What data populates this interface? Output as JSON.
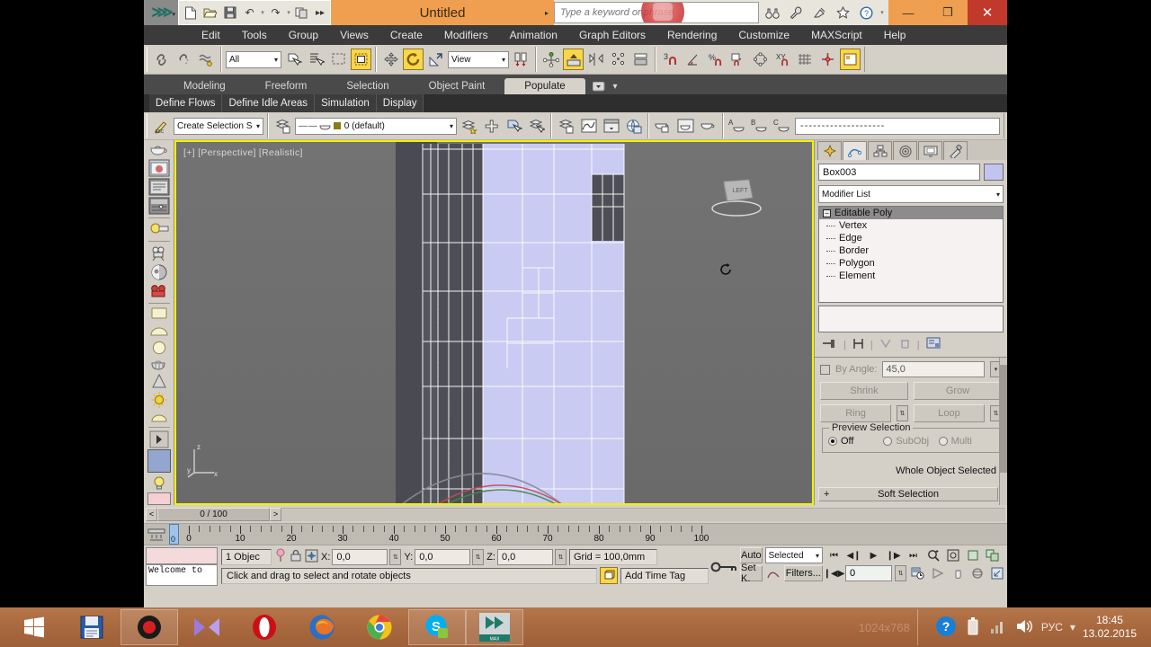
{
  "titlebar": {
    "app_logo": "3dsmax-logo-icon",
    "quick_access": [
      {
        "name": "new-file-icon",
        "glyph": "🗋"
      },
      {
        "name": "open-file-icon",
        "glyph": "🗁"
      },
      {
        "name": "save-file-icon",
        "glyph": "🖫"
      },
      {
        "name": "undo-icon",
        "glyph": "↶"
      },
      {
        "name": "redo-icon",
        "glyph": "↷"
      },
      {
        "name": "set-project-folder-icon",
        "glyph": "🗂"
      }
    ],
    "title": "Untitled",
    "search_placeholder": "Type a keyword or phrase",
    "help_icons": [
      "binoculars-icon",
      "wrench-icon",
      "satellite-icon",
      "star-icon",
      "help-icon"
    ],
    "window_buttons": {
      "minimize": "—",
      "maximize": "❐",
      "close": "✕"
    }
  },
  "menubar": {
    "items": [
      "Edit",
      "Tools",
      "Group",
      "Views",
      "Create",
      "Modifiers",
      "Animation",
      "Graph Editors",
      "Rendering",
      "Customize",
      "MAXScript",
      "Help"
    ]
  },
  "main_toolbar": {
    "selection_filter": "All",
    "reference_coordinate_system": "View",
    "active_tool": "rotate",
    "groups": [
      {
        "name": "link-group",
        "icons": [
          "select-and-link-icon",
          "unlink-selection-icon",
          "bind-to-space-warp-icon"
        ]
      },
      {
        "name": "select-group",
        "icons": [
          "select-object-icon",
          "select-by-name-icon",
          "rectangular-region-icon",
          "window-crossing-icon"
        ]
      },
      {
        "name": "transform-group",
        "icons": [
          "select-and-move-icon",
          "select-and-rotate-icon",
          "select-and-scale-icon"
        ]
      },
      {
        "name": "pivot-group",
        "icons": [
          "use-pivot-point-center-icon",
          "selection-lock-toggle-icon"
        ]
      },
      {
        "name": "align-group",
        "icons": [
          "mirror-icon",
          "align-icon",
          "layer-manager-icon"
        ]
      },
      {
        "name": "snap-group",
        "icons": [
          "snaps-toggle-3-icon",
          "angle-snap-icon",
          "percent-snap-icon",
          "spinner-snap-icon",
          "named-selection-icon",
          "xy-icon",
          "grid-icon",
          "manipulate-icon",
          "render-setup-icon"
        ]
      }
    ]
  },
  "ribbon": {
    "tabs": [
      {
        "label": "Modeling",
        "active": false
      },
      {
        "label": "Freeform",
        "active": false
      },
      {
        "label": "Selection",
        "active": false
      },
      {
        "label": "Object Paint",
        "active": false
      },
      {
        "label": "Populate",
        "active": true
      }
    ],
    "dropdown_icon": "ribbon-options-icon",
    "subtabs": [
      "Define Flows",
      "Define Idle Areas",
      "Simulation",
      "Display"
    ]
  },
  "layer_toolbar": {
    "selection_set": "Create Selection Se",
    "layer": "0 (default)",
    "layer_icons": [
      "layer-manager-icon",
      "create-layer-icon",
      "add-to-layer-icon",
      "select-layer-objects-icon"
    ],
    "curve_editor_icons": [
      "curve-editor-icon",
      "schematic-view-icon",
      "track-view-icon",
      "render-in-browser-icon"
    ],
    "material_icons": [
      "material-editor-icon",
      "compact-material-editor-icon",
      "material-explorer-icon"
    ],
    "abc_icons": [
      "render-production-icon",
      "render-iterative-icon",
      "render-activeshade-icon"
    ],
    "material_dash": "- - - - - - - - - - - - - - - - - - - -"
  },
  "left_toolbar": {
    "items": [
      "teapot-icon",
      "render-frame-icon",
      "render-setup-icon",
      "render-presets-icon",
      "light-lister-icon",
      "camera-icon",
      "shadow-icon",
      "camera-red-icon",
      "box-primitive-icon",
      "sphere-primitive-icon",
      "circle-primitive-icon",
      "teapot-primitive-icon",
      "cone-primitive-icon",
      "sun-icon",
      "light-icon"
    ]
  },
  "viewport": {
    "label": "[+] [Perspective] [Realistic]",
    "viewcube_face": "LEFT",
    "cursor": "rotate-cursor",
    "axis_labels": {
      "z": "z",
      "y": "y",
      "x": "x"
    },
    "border_color": "#f5f000",
    "selection_color": "#c9cbf2",
    "object_name": "Box003"
  },
  "command_panel": {
    "tabs": [
      "create-tab-icon",
      "modify-tab-icon",
      "hierarchy-tab-icon",
      "motion-tab-icon",
      "display-tab-icon",
      "utilities-tab-icon"
    ],
    "active_tab_index": 1,
    "object_name": "Box003",
    "color_swatch": "#c3c3ef",
    "modifier_list_label": "Modifier List",
    "modifier_stack": {
      "root": "Editable Poly",
      "sub_objects": [
        "Vertex",
        "Edge",
        "Border",
        "Polygon",
        "Element"
      ]
    },
    "stack_buttons": [
      "pin-stack-icon",
      "show-end-result-icon",
      "make-unique-icon",
      "remove-modifier-icon",
      "configure-sets-icon"
    ],
    "selection_rollout": {
      "by_angle_label": "By Angle:",
      "by_angle_value": "45,0",
      "shrink": "Shrink",
      "grow": "Grow",
      "ring": "Ring",
      "loop": "Loop",
      "preview_title": "Preview Selection",
      "preview_options": [
        {
          "label": "Off",
          "selected": true
        },
        {
          "label": "SubObj",
          "selected": false
        },
        {
          "label": "Multi",
          "selected": false
        }
      ],
      "status": "Whole Object Selected"
    },
    "soft_selection": "Soft Selection"
  },
  "timeline": {
    "prev_arrow": "<",
    "next_arrow": ">",
    "current": "0 / 100",
    "frame_indicator": "0",
    "ruler_labels": [
      "0",
      "10",
      "20",
      "30",
      "40",
      "50",
      "60",
      "70",
      "80",
      "90",
      "100"
    ],
    "range_start": 0,
    "range_end": 100
  },
  "statusbar": {
    "listener_text": "Welcome to",
    "object_count": "1 Objec",
    "lock_icons": [
      "pink-pin-icon",
      "selection-lock-icon",
      "absolute-relative-icon"
    ],
    "coords": [
      {
        "label": "X:",
        "value": "0,0"
      },
      {
        "label": "Y:",
        "value": "0,0"
      },
      {
        "label": "Z:",
        "value": "0,0"
      }
    ],
    "grid": "Grid = 100,0mm",
    "prompt": "Click and drag to select and rotate objects",
    "add_time_tag": "Add Time Tag",
    "key_mode_icon": "key-mode-icon",
    "auto_key": "Auto",
    "set_key": "Set K.",
    "key_filter_selected": "Selected",
    "filters": "Filters...",
    "playback_icons": [
      "go-to-start-icon",
      "previous-frame-icon",
      "play-icon",
      "next-frame-icon",
      "go-to-end-icon"
    ],
    "current_frame": "0",
    "nav_icons_row1": [
      "zoom-icon",
      "zoom-all-icon",
      "zoom-extents-icon",
      "zoom-region-icon"
    ],
    "nav_icons_row2": [
      "key-mode-toggle-icon",
      "field-of-view-icon",
      "pan-icon",
      "orbit-icon",
      "maximize-viewport-icon"
    ]
  },
  "taskbar": {
    "start_icon": "windows-start-icon",
    "items": [
      {
        "name": "taskbar-save-icon",
        "active": false
      },
      {
        "name": "taskbar-recorder-icon",
        "active": true
      },
      {
        "name": "taskbar-media-player-icon",
        "active": false
      },
      {
        "name": "taskbar-opera-icon",
        "active": false
      },
      {
        "name": "taskbar-firefox-icon",
        "active": false
      },
      {
        "name": "taskbar-chrome-icon",
        "active": false
      },
      {
        "name": "taskbar-skype-icon",
        "active": true
      },
      {
        "name": "taskbar-3dsmax-icon",
        "active": true
      }
    ],
    "resolution_ghost": "1024x768",
    "tray_icons": [
      "help-icon",
      "battery-icon",
      "network-icon",
      "volume-icon"
    ],
    "language": "РУС",
    "time": "18:45",
    "date": "13.02.2015"
  }
}
